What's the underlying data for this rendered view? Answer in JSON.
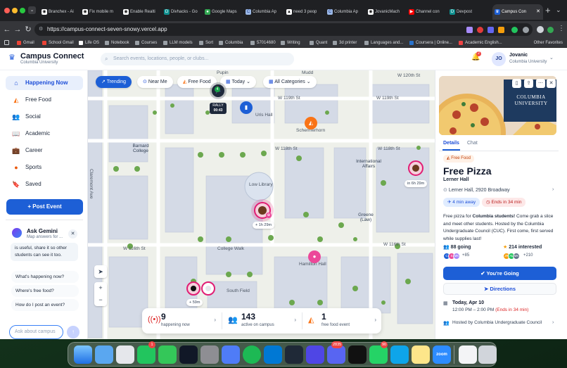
{
  "browser": {
    "tabs": [
      {
        "label": "Branchex - Ai",
        "icon": "github-icon"
      },
      {
        "label": "Fix mobile m",
        "icon": "github-icon"
      },
      {
        "label": "Enable Realti",
        "icon": "github-icon"
      },
      {
        "label": "Divhacks - Go",
        "icon": "devpost-icon"
      },
      {
        "label": "Google Maps",
        "icon": "maps-icon"
      },
      {
        "label": "Columbia Ap",
        "icon": "columbia-icon"
      },
      {
        "label": "need 3 peop",
        "icon": "columbia-icon"
      },
      {
        "label": "Columbia Ap",
        "icon": "columbia-icon"
      },
      {
        "label": "JovanicMach",
        "icon": "github-icon"
      },
      {
        "label": "Channel con",
        "icon": "youtube-icon"
      },
      {
        "label": "Devpost",
        "icon": "devpost-icon"
      },
      {
        "label": "Campus Con",
        "icon": "campus-icon"
      }
    ],
    "url": "https://campus-connect-seven-snowy.vercel.app",
    "bookmarks": [
      "Gmail",
      "School Gmail",
      "Life OS",
      "Notebook",
      "Courses",
      "LLM models",
      "Sort",
      "Columbia",
      "57014680",
      "Writing",
      "Quant",
      "3d printer",
      "Languages and...",
      "Coursera | Online...",
      "Academic English..."
    ],
    "all_bookmarks": "Other Favorites"
  },
  "header": {
    "brand": "Campus Connect",
    "brand_sub": "Columbia University",
    "search_placeholder": "Search events, locations, people, or clubs...",
    "notifications": "2",
    "avatar": "JO",
    "user_name": "Jovanic",
    "user_school": "Columbia University"
  },
  "sidebar": {
    "items": [
      {
        "label": "Happening Now",
        "icon": "home-icon"
      },
      {
        "label": "Free Food",
        "icon": "pizza-icon"
      },
      {
        "label": "Social",
        "icon": "people-icon"
      },
      {
        "label": "Academic",
        "icon": "book-icon"
      },
      {
        "label": "Career",
        "icon": "briefcase-icon"
      },
      {
        "label": "Sports",
        "icon": "basketball-icon"
      },
      {
        "label": "Saved",
        "icon": "bookmark-icon"
      }
    ],
    "post_button": "Post Event",
    "gemini": {
      "title": "Ask Gemini",
      "subtitle": "Map answers for ...",
      "message": "is useful, share it so other students can see it too.",
      "suggestions": [
        "What's happening now?",
        "Where's free food?",
        "How do I post an event?"
      ],
      "input_placeholder": "Ask about campus"
    }
  },
  "map": {
    "filters": {
      "trending": "Trending",
      "near_me": "Near Me",
      "free_food": "Free Food",
      "today": "Today",
      "categories": "All Categories"
    },
    "labels": {
      "pupin": "Pupin",
      "mudd": "Mudd",
      "w120": "W 120th St",
      "w119a": "W 119th St",
      "w119b": "W 119th St",
      "w118a": "W 118th St",
      "w118b": "W 118th St",
      "urishall": "Uris Hall",
      "schermerhorn": "Schermerhorn",
      "barnard": "Barnard College",
      "claremont": "Claremont Ave",
      "lowlib": "Low Library",
      "intaff": "International Affairs",
      "greene": "Greene (Law)",
      "w116a": "W 116th St",
      "w116b": "W 116th St",
      "collegewalk": "College Walk",
      "hamilton": "Hamilton Hall",
      "southfield": "South Field"
    },
    "rally": {
      "label": "RALLY",
      "time": "00:43"
    },
    "markers": {
      "m1_tag": "+ 1h 29m",
      "m2_tag": "in 6h 29m",
      "m3_tag": "+ 59m"
    },
    "stats": [
      {
        "value": "9",
        "label": "happening now"
      },
      {
        "value": "143",
        "label": "active on campus"
      },
      {
        "value": "1",
        "label": "free food event"
      }
    ]
  },
  "event": {
    "hero_sign": "COLUMBIA UNIVERSITY",
    "tabs": [
      "Details",
      "Chat"
    ],
    "badge": "Free Food",
    "title": "Free Pizza",
    "venue": "Lerner Hall",
    "address": "Lerner Hall, 2920 Broadway",
    "walk": "4 min away",
    "ends": "Ends in 34 min",
    "desc_1": "Free pizza for ",
    "desc_bold": "Columbia students!",
    "desc_2": " Come grab a slice and meet other students. Hosted by the Columbia Undergraduate Council (CUC). First come, first served while supplies last!",
    "going": "88 going",
    "interested": "214 interested",
    "going_more": "+85",
    "interested_more": "+210",
    "going_avatars": [
      "C",
      "S",
      "MK"
    ],
    "interested_avatars": [
      "JR",
      "AL",
      "MK"
    ],
    "going_button": "You're Going",
    "directions_button": "Directions",
    "date": "Today, Apr 10",
    "time": "12:00 PM – 2:00 PM",
    "time_note": "(Ends in 34 min)",
    "host": "Hosted by Columbia Undergraduate Council"
  },
  "dock": {
    "badges": {
      "facetime": "1",
      "discord": "2835",
      "whatsapp": "90"
    },
    "zoom_label": "zoom"
  },
  "colors": {
    "accent": "#1d5fd6",
    "food_orange": "#f97316",
    "marker_pink": "#e11d74",
    "danger": "#dc2626"
  }
}
